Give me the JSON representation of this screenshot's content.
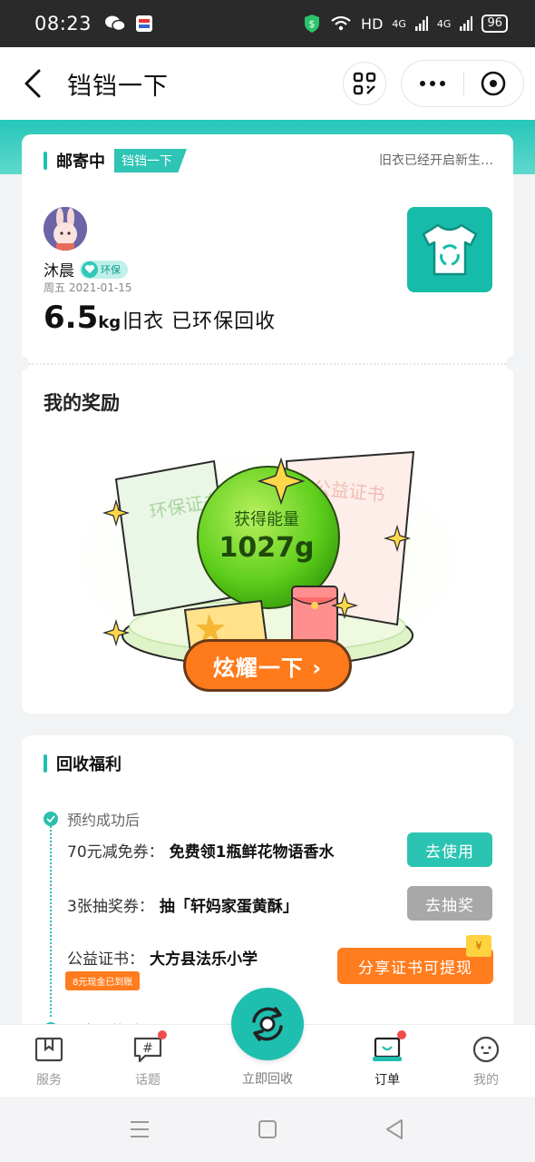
{
  "status_bar": {
    "time": "08:23",
    "network": "HD",
    "signal1": "4G",
    "signal2": "4G",
    "battery": "96"
  },
  "navbar": {
    "title": "铛铛一下"
  },
  "card_pickup": {
    "status": "邮寄中",
    "tag": "铛铛一下",
    "note": "旧衣已经开启新生…",
    "username": "沐晨",
    "badge": "环保",
    "date": "周五 2021-01-15",
    "weight": "6.5",
    "unit": "kg",
    "summary": "旧衣 已环保回收"
  },
  "reward": {
    "title": "我的奖励",
    "energy_label": "获得能量",
    "energy_value": "1027g",
    "cert_left": "环保证书",
    "cert_right": "公益证书",
    "show_button": "炫耀一下 ›"
  },
  "benefits": {
    "title": "回收福利",
    "step1": "预约成功后",
    "rows": [
      {
        "key": "70元减免券：",
        "value": "免费领1瓶鲜花物语香水",
        "button": "去使用"
      },
      {
        "key": "3张抽奖券：",
        "value": "抽「轩妈家蛋黄酥」",
        "button": "去抽奖"
      },
      {
        "key": "公益证书：",
        "value": "大方县法乐小学",
        "button": "分享证书可提现"
      }
    ],
    "cash_note": "8元现金已到账",
    "coin": "¥",
    "step2": "旧衣取件后"
  },
  "tabbar": {
    "tabs": [
      {
        "label": "服务"
      },
      {
        "label": "话题"
      },
      {
        "label": "立即回收"
      },
      {
        "label": "订单"
      },
      {
        "label": "我的"
      }
    ]
  }
}
